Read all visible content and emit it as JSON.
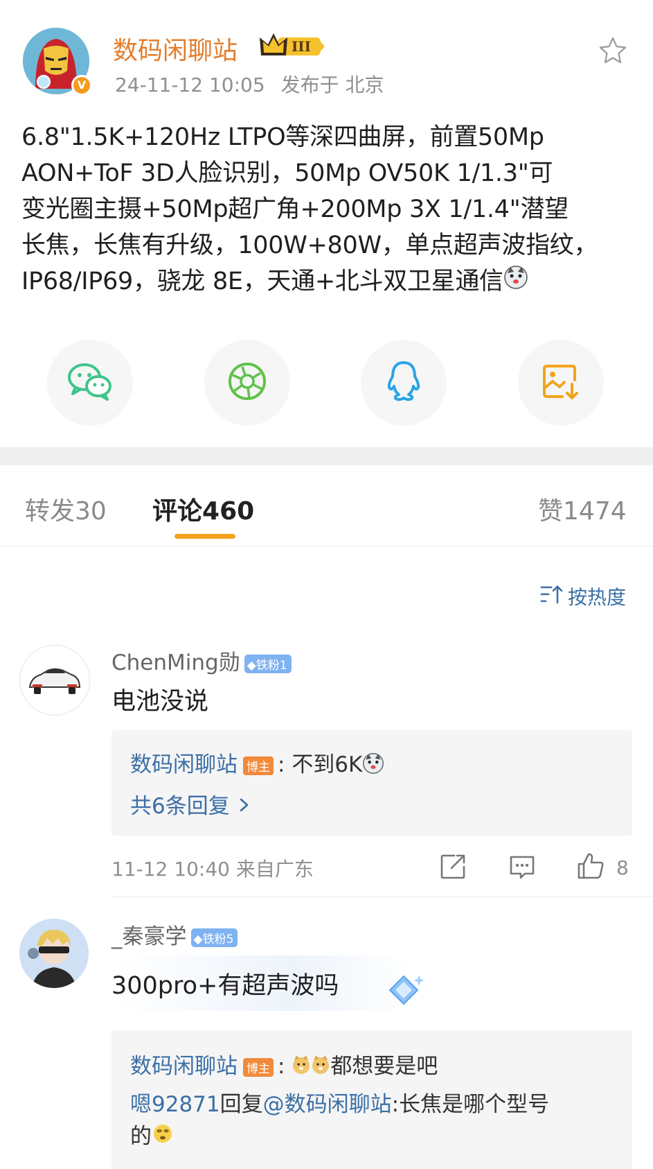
{
  "post": {
    "author": "数码闲聊站",
    "level_badge": "III",
    "timestamp": "24-11-12 10:05",
    "location": "发布于 北京",
    "lines": [
      "6.8\"1.5K+120Hz LTPO等深四曲屏，前置50Mp",
      "AON+ToF 3D人脸识别，50Mp OV50K 1/1.3\"可",
      "变光圈主摄+50Mp超广角+200Mp 3X 1/1.4\"潜望",
      "长焦，长焦有升级，100W+80W，单点超声波指纹，",
      "IP68/IP69，骁龙 8E，天通+北斗双卫星通信"
    ]
  },
  "share": [
    {
      "name": "wechat-icon",
      "color": "#3fc58a"
    },
    {
      "name": "moments-icon",
      "color": "#5ec24a"
    },
    {
      "name": "qq-icon",
      "color": "#2aa4e8"
    },
    {
      "name": "save-image-icon",
      "color": "#f2a31c"
    }
  ],
  "tabs": {
    "repost_label": "转发",
    "repost_count": "30",
    "comment_label": "评论",
    "comment_count": "460",
    "like_label": "赞",
    "like_count": "1474"
  },
  "sort_label": "按热度",
  "comments": [
    {
      "user": "ChenMing勋",
      "fan_badge": "铁粉1",
      "text": "电池没说",
      "reply": {
        "author": "数码闲聊站",
        "host_badge": "博主",
        "text": "不到6K"
      },
      "more_replies": "共6条回复",
      "time_location": "11-12 10:40 来自广东",
      "likes": "8"
    },
    {
      "user": "_秦豪学",
      "fan_badge": "铁粉5",
      "text": "300pro+有超声波吗",
      "reply": {
        "author": "数码闲聊站",
        "host_badge": "博主",
        "text": "都想要是吧"
      },
      "reply2": {
        "user": "嗯92871",
        "action": "回复",
        "mention": "@数码闲聊站",
        "text_line1": ":长焦是哪个型号",
        "text_line2": "的"
      }
    }
  ]
}
